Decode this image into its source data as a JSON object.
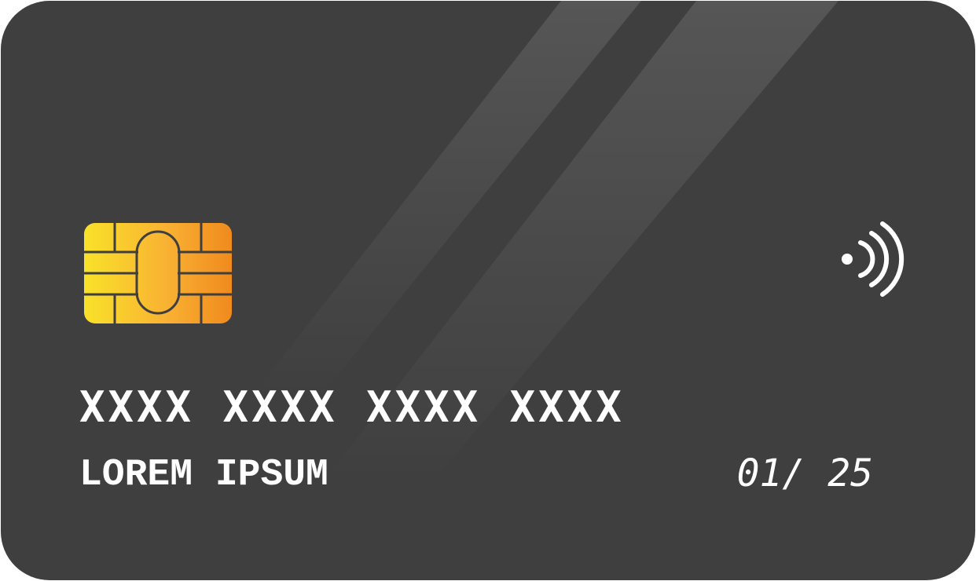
{
  "card": {
    "number": "XXXX XXXX XXXX XXXX",
    "holder_name": "LOREM IPSUM",
    "expiry": "01/ 25",
    "background_color": "#3f3f3f",
    "text_color": "#ffffff",
    "chip_gradient": [
      "#f9e22a",
      "#f08a1e"
    ]
  },
  "icons": {
    "chip": "emv-chip-icon",
    "contactless": "contactless-payment-icon"
  }
}
